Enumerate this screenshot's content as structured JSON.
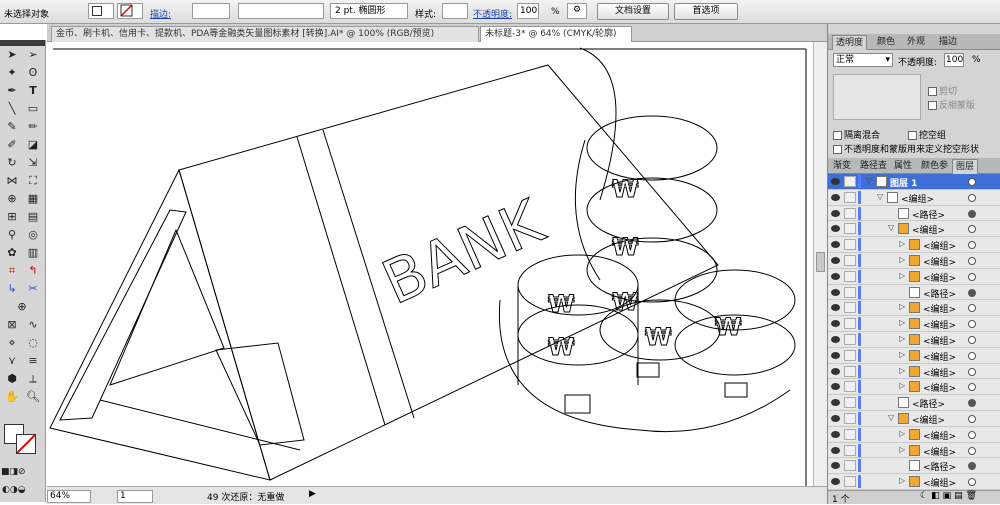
{
  "control_bar": {
    "object_label": "未选择对象",
    "stroke_label": "描边:",
    "stroke_width": "2 pt. 椭圆形",
    "style_label": "样式:",
    "opacity_label": "不透明度:",
    "opacity_value": "100",
    "opacity_unit": "%",
    "doc_settings_button": "文档设置",
    "preferences_button": "首选项"
  },
  "doc_tabs": [
    {
      "title": "金币、刷卡机、信用卡、提款机、PDA等金融类矢量图标素材 [转换].AI* @ 100% (RGB/预览)"
    },
    {
      "title": "未标题-3* @ 64% (CMYK/轮廓)"
    }
  ],
  "canvas": {
    "bank_text": "BANK"
  },
  "status": {
    "zoom": "64%",
    "page": "1",
    "undo": "49 次还原：无重做"
  },
  "transparency": {
    "tabs": [
      "透明度",
      "颜色",
      "外观",
      "描边"
    ],
    "blend_mode": "正常",
    "opacity_label": "不透明度:",
    "opacity_value": "100",
    "opacity_unit": "%",
    "clip_label": "剪切",
    "invert_mask_label": "反相蒙版",
    "isolate_blend_label": "隔离混合",
    "knockout_group_label": "挖空组",
    "opacity_mask_label": "不透明度和蒙版用来定义挖空形状"
  },
  "layers": {
    "tabs": [
      "渐变",
      "路径查",
      "属性",
      "颜色参",
      "图层"
    ],
    "rows": [
      {
        "label": "图层 1",
        "indent": 0,
        "type": "layer"
      },
      {
        "label": "<编组>",
        "indent": 1,
        "type": "group"
      },
      {
        "label": "<路径>",
        "indent": 2,
        "type": "path"
      },
      {
        "label": "<编组>",
        "indent": 2,
        "type": "group"
      },
      {
        "label": "<编组>",
        "indent": 3,
        "type": "group"
      },
      {
        "label": "<编组>",
        "indent": 3,
        "type": "group"
      },
      {
        "label": "<编组>",
        "indent": 3,
        "type": "group"
      },
      {
        "label": "<路径>",
        "indent": 3,
        "type": "path"
      },
      {
        "label": "<编组>",
        "indent": 3,
        "type": "group"
      },
      {
        "label": "<编组>",
        "indent": 3,
        "type": "group"
      },
      {
        "label": "<编组>",
        "indent": 3,
        "type": "group"
      },
      {
        "label": "<编组>",
        "indent": 3,
        "type": "group"
      },
      {
        "label": "<编组>",
        "indent": 3,
        "type": "group"
      },
      {
        "label": "<编组>",
        "indent": 3,
        "type": "group"
      },
      {
        "label": "<路径>",
        "indent": 2,
        "type": "path"
      },
      {
        "label": "<编组>",
        "indent": 2,
        "type": "group"
      },
      {
        "label": "<编组>",
        "indent": 3,
        "type": "group"
      },
      {
        "label": "<编组>",
        "indent": 3,
        "type": "group"
      },
      {
        "label": "<路径>",
        "indent": 3,
        "type": "path"
      },
      {
        "label": "<编组>",
        "indent": 3,
        "type": "group"
      }
    ],
    "footer_count": "1 个"
  }
}
